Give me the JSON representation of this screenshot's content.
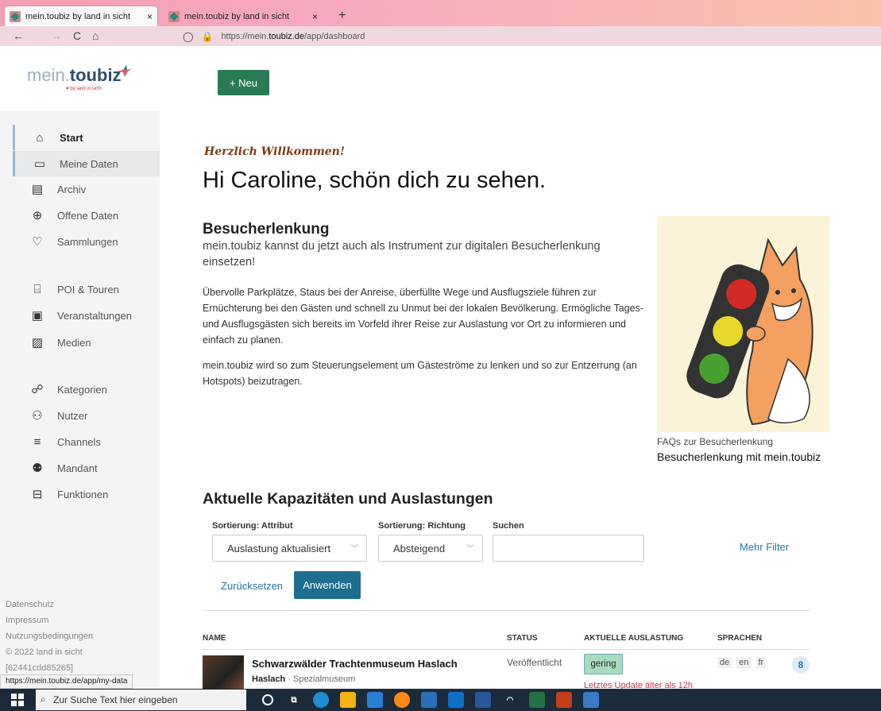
{
  "browser": {
    "tabs": [
      {
        "title": "mein.toubiz by land in sicht",
        "close": "×"
      },
      {
        "title": "mein.toubiz by land in sicht",
        "close": "×"
      }
    ],
    "new_tab": "+",
    "nav": {
      "back": "←",
      "forward": "→",
      "reload": "C",
      "home": "⌂"
    },
    "url_prefix": "https://mein.",
    "url_host": "toubiz.de",
    "url_path": "/app/dashboard",
    "status_url": "https://mein.toubiz.de/app/my-data"
  },
  "header": {
    "logo_light": "mein.",
    "logo_bold": "toubiz",
    "logo_sub": "♥ by land in sicht",
    "new_button": "+ Neu"
  },
  "sidebar": {
    "items": [
      {
        "label": "Start",
        "icon": "⌂"
      },
      {
        "label": "Meine Daten",
        "icon": "▭"
      },
      {
        "label": "Archiv",
        "icon": "▤"
      },
      {
        "label": "Offene Daten",
        "icon": "⊕"
      },
      {
        "label": "Sammlungen",
        "icon": "♡"
      },
      {
        "label": "POI & Touren",
        "icon": "⌸"
      },
      {
        "label": "Veranstaltungen",
        "icon": "▣"
      },
      {
        "label": "Medien",
        "icon": "▨"
      },
      {
        "label": "Kategorien",
        "icon": "☍"
      },
      {
        "label": "Nutzer",
        "icon": "⚇"
      },
      {
        "label": "Channels",
        "icon": "≡"
      },
      {
        "label": "Mandant",
        "icon": "⚉"
      },
      {
        "label": "Funktionen",
        "icon": "⊟"
      }
    ],
    "footer": [
      "Datenschutz",
      "Impressum",
      "Nutzungsbedingungen",
      "© 2022 land in sicht",
      "[62441cdd85265]"
    ]
  },
  "main": {
    "welcome": "Herzlich Willkommen!",
    "greeting": "Hi Caroline, schön dich zu sehen.",
    "section_title": "Besucherlenkung",
    "section_lead": "mein.toubiz kannst du jetzt auch als Instrument zur digitalen Besucherlenkung einsetzen!",
    "para1": "Übervolle Parkplätze, Staus bei der Anreise, überfüllte Wege und Ausflugsziele führen zur Ernüchterung bei den Gästen und schnell zu Unmut bei der lokalen Bevölkerung. Ermögliche Tages- und Ausflugsgästen sich bereits im Vorfeld ihrer Reise zur Auslastung vor Ort zu informieren und einfach zu planen.",
    "para2": "mein.toubiz wird so zum Steuerungselement um Gästeströme zu lenken und so zur Entzerrung (an Hotspots) beizutragen.",
    "faq_caption": "FAQs zur Besucherlenkung",
    "faq_title": "Besucherlenkung mit mein.toubiz"
  },
  "capacity": {
    "title": "Aktuelle Kapazitäten und Auslastungen",
    "sort_attr_label": "Sortierung: Attribut",
    "sort_attr_value": "Auslastung aktualisiert",
    "sort_dir_label": "Sortierung: Richtung",
    "sort_dir_value": "Absteigend",
    "search_label": "Suchen",
    "search_value": "",
    "more_filter": "Mehr Filter",
    "reset": "Zurücksetzen",
    "apply": "Anwenden",
    "columns": {
      "name": "NAME",
      "status": "STATUS",
      "load": "AKTUELLE AUSLASTUNG",
      "langs": "SPRACHEN"
    },
    "rows": [
      {
        "name": "Schwarzwälder Trachtenmuseum Haslach",
        "place": "Haslach",
        "sep": " · ",
        "category": "Spezialmuseum",
        "status": "Veröffentlicht",
        "load": "gering",
        "note": "Letztes Update älter als 12h",
        "langs": [
          "de",
          "en",
          "fr"
        ],
        "count": "8"
      }
    ]
  },
  "taskbar": {
    "search_placeholder": "Zur Suche Text hier eingeben"
  },
  "colors": {
    "primary_green": "#2a7a56",
    "primary_blue": "#1d6e8f",
    "link_blue": "#2675a8",
    "badge_green": "#a8dcc0",
    "warn_red": "#c0364b"
  }
}
